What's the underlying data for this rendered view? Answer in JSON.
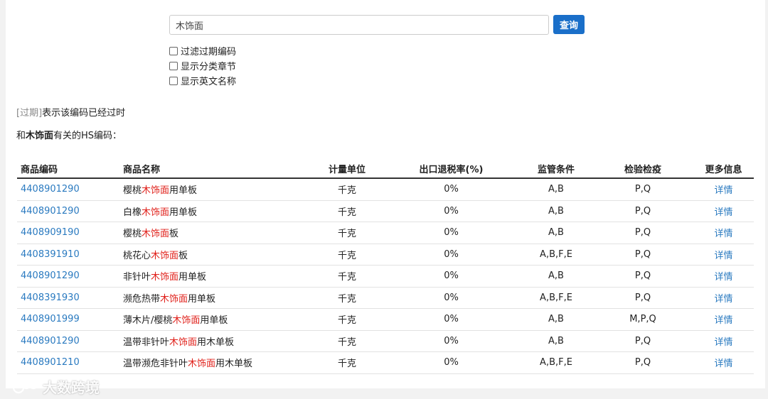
{
  "search": {
    "value": "木饰面",
    "button_label": "查询"
  },
  "options": [
    {
      "label": "过滤过期编码",
      "checked": false
    },
    {
      "label": "显示分类章节",
      "checked": false
    },
    {
      "label": "显示英文名称",
      "checked": false
    }
  ],
  "note": {
    "tag": "[过期]",
    "text": "表示该编码已经过时"
  },
  "related": {
    "prefix": "和",
    "keyword": "木饰面",
    "suffix": "有关的HS编码："
  },
  "table": {
    "headers": [
      "商品编码",
      "商品名称",
      "计量单位",
      "出口退税率(%)",
      "监管条件",
      "检验检疫",
      "更多信息"
    ],
    "rows": [
      {
        "code": "4408901290",
        "name_pre": "樱桃",
        "name_hl": "木饰面",
        "name_post": "用单板",
        "unit": "千克",
        "rate": "0%",
        "supervision": "A,B",
        "inspection": "P,Q",
        "more": "详情"
      },
      {
        "code": "4408901290",
        "name_pre": "白橡",
        "name_hl": "木饰面",
        "name_post": "用单板",
        "unit": "千克",
        "rate": "0%",
        "supervision": "A,B",
        "inspection": "P,Q",
        "more": "详情"
      },
      {
        "code": "4408909190",
        "name_pre": "樱桃",
        "name_hl": "木饰面",
        "name_post": "板",
        "unit": "千克",
        "rate": "0%",
        "supervision": "A,B",
        "inspection": "P,Q",
        "more": "详情"
      },
      {
        "code": "4408391910",
        "name_pre": "桃花心",
        "name_hl": "木饰面",
        "name_post": "板",
        "unit": "千克",
        "rate": "0%",
        "supervision": "A,B,F,E",
        "inspection": "P,Q",
        "more": "详情"
      },
      {
        "code": "4408901290",
        "name_pre": "非针叶",
        "name_hl": "木饰面",
        "name_post": "用单板",
        "unit": "千克",
        "rate": "0%",
        "supervision": "A,B",
        "inspection": "P,Q",
        "more": "详情"
      },
      {
        "code": "4408391930",
        "name_pre": "濒危热带",
        "name_hl": "木饰面",
        "name_post": "用单板",
        "unit": "千克",
        "rate": "0%",
        "supervision": "A,B,F,E",
        "inspection": "P,Q",
        "more": "详情"
      },
      {
        "code": "4408901999",
        "name_pre": "薄木片/樱桃",
        "name_hl": "木饰面",
        "name_post": "用单板",
        "unit": "千克",
        "rate": "0%",
        "supervision": "A,B",
        "inspection": "M,P,Q",
        "more": "详情"
      },
      {
        "code": "4408901290",
        "name_pre": "温带非针叶",
        "name_hl": "木饰面",
        "name_post": "用木单板",
        "unit": "千克",
        "rate": "0%",
        "supervision": "A,B",
        "inspection": "P,Q",
        "more": "详情"
      },
      {
        "code": "4408901210",
        "name_pre": "温带濒危非针叶",
        "name_hl": "木饰面",
        "name_post": "用木单板",
        "unit": "千克",
        "rate": "0%",
        "supervision": "A,B,F,E",
        "inspection": "P,Q",
        "more": "详情"
      }
    ]
  },
  "watermark": "大数跨境"
}
